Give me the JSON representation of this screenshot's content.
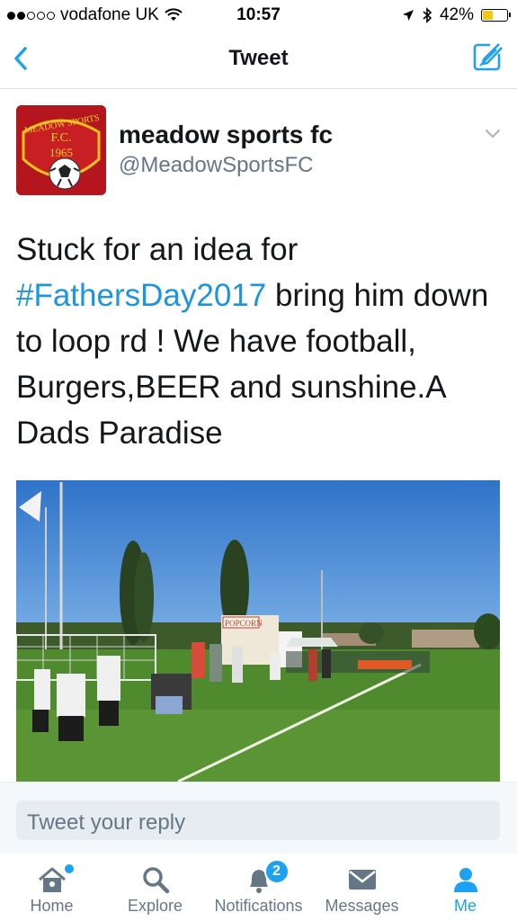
{
  "status_bar": {
    "carrier": "vodafone UK",
    "time": "10:57",
    "battery": "42%",
    "battery_level": 0.42
  },
  "nav": {
    "title": "Tweet"
  },
  "tweet": {
    "display_name": "meadow sports fc",
    "handle": "@MeadowSportsFC",
    "avatar_text": {
      "line1": "MEADOW SPORTS",
      "line2": "F.C.",
      "line3": "1965"
    },
    "text_before": "Stuck for an idea for ",
    "hashtag": "#FathersDay2017",
    "text_after": " bring him down to loop rd ! We have football, Burgers,BEER and sunshine.A Dads Paradise",
    "photo_sign": "POPCORN"
  },
  "reply": {
    "placeholder": "Tweet your reply"
  },
  "tabs": [
    {
      "label": "Home",
      "icon": "home-icon"
    },
    {
      "label": "Explore",
      "icon": "search-icon"
    },
    {
      "label": "Notifications",
      "icon": "bell-icon",
      "badge": "2"
    },
    {
      "label": "Messages",
      "icon": "envelope-icon"
    },
    {
      "label": "Me",
      "icon": "person-icon",
      "active": true
    }
  ],
  "colors": {
    "accent": "#1da1f2",
    "hashtag": "#1b95e0",
    "muted": "#657786"
  }
}
